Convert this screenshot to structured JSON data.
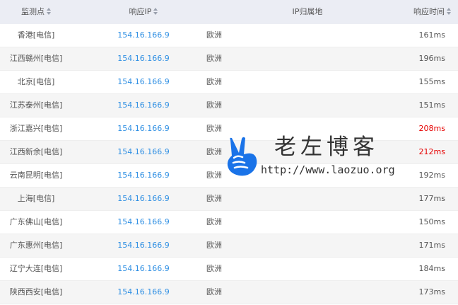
{
  "header": {
    "site": "监测点",
    "ip": "响应IP",
    "location": "IP归属地",
    "time": "响应时间"
  },
  "colors": {
    "header_bg": "#ebedf4",
    "ip_link": "#2f8fe3",
    "slow_time": "#e60000",
    "alt_row": "#f5f5f5",
    "watermark_blue": "#1a73e8"
  },
  "rows": [
    {
      "site": "香港[电信]",
      "ip": "154.16.166.9",
      "location": "欧洲",
      "time": "161ms",
      "slow": false
    },
    {
      "site": "江西赣州[电信]",
      "ip": "154.16.166.9",
      "location": "欧洲",
      "time": "196ms",
      "slow": false
    },
    {
      "site": "北京[电信]",
      "ip": "154.16.166.9",
      "location": "欧洲",
      "time": "155ms",
      "slow": false
    },
    {
      "site": "江苏泰州[电信]",
      "ip": "154.16.166.9",
      "location": "欧洲",
      "time": "151ms",
      "slow": false
    },
    {
      "site": "浙江嘉兴[电信]",
      "ip": "154.16.166.9",
      "location": "欧洲",
      "time": "208ms",
      "slow": true
    },
    {
      "site": "江西新余[电信]",
      "ip": "154.16.166.9",
      "location": "欧洲",
      "time": "212ms",
      "slow": true
    },
    {
      "site": "云南昆明[电信]",
      "ip": "154.16.166.9",
      "location": "欧洲",
      "time": "192ms",
      "slow": false
    },
    {
      "site": "上海[电信]",
      "ip": "154.16.166.9",
      "location": "欧洲",
      "time": "177ms",
      "slow": false
    },
    {
      "site": "广东佛山[电信]",
      "ip": "154.16.166.9",
      "location": "欧洲",
      "time": "150ms",
      "slow": false
    },
    {
      "site": "广东惠州[电信]",
      "ip": "154.16.166.9",
      "location": "欧洲",
      "time": "171ms",
      "slow": false
    },
    {
      "site": "辽宁大连[电信]",
      "ip": "154.16.166.9",
      "location": "欧洲",
      "time": "184ms",
      "slow": false
    },
    {
      "site": "陕西西安[电信]",
      "ip": "154.16.166.9",
      "location": "欧洲",
      "time": "173ms",
      "slow": false
    }
  ],
  "watermark": {
    "title": "老左博客",
    "url": "http://www.laozuo.org",
    "icon": "victory-hand-icon"
  }
}
